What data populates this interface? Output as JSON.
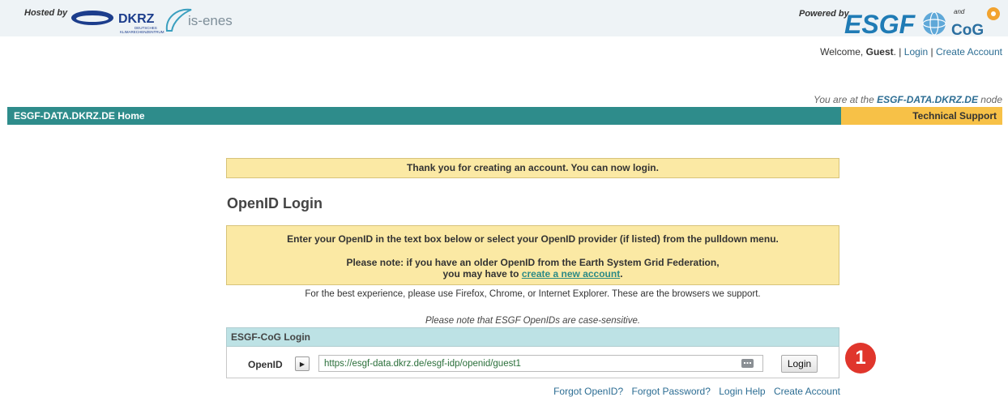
{
  "header": {
    "hosted_by": "Hosted by",
    "dkrz_name": "DKRZ",
    "dkrz_sub1": "DEUTSCHES",
    "dkrz_sub2": "KLIMARECHENZENTRUM",
    "isenes_name": "is-enes",
    "powered_by": "Powered by",
    "esgf_name": "ESGF",
    "cog_and": "and",
    "cog_name": "CoG",
    "welcome_prefix": "Welcome, ",
    "welcome_user": "Guest",
    "welcome_suffix": ".",
    "login_link": "Login",
    "create_account_link": "Create Account",
    "node_prefix": "You are at the ",
    "node_name": "ESGF-DATA.DKRZ.DE",
    "node_suffix": " node"
  },
  "nav": {
    "home": "ESGF-DATA.DKRZ.DE Home",
    "support": "Technical Support"
  },
  "main": {
    "thank_you": "Thank you for creating an account. You can now login.",
    "title": "OpenID Login",
    "info_line1": "Enter your OpenID in the text box below or select your OpenID provider (if listed) from the pulldown menu.",
    "info_line2": "Please note: if you have an older OpenID from the Earth System Grid Federation,",
    "info_line3_prefix": "you may have to ",
    "info_line3_link": "create a new account",
    "info_line3_suffix": ".",
    "browsers_note": "For the best experience, please use Firefox, Chrome, or Internet Explorer. These are the browsers we support.",
    "case_note": "Please note that ESGF OpenIDs are case-sensitive."
  },
  "login_form": {
    "header": "ESGF-CoG Login",
    "openid_label": "OpenID",
    "openid_value": "https://esgf-data.dkrz.de/esgf-idp/openid/guest1",
    "login_button": "Login",
    "annotation_number": "1"
  },
  "footer_links": {
    "forgot_openid": "Forgot OpenID?",
    "forgot_password": "Forgot Password?",
    "login_help": "Login Help",
    "create_account": "Create Account"
  },
  "colors": {
    "nav_bg": "#2e8c8b",
    "support_bg": "#f7c147",
    "notice_bg": "#fbe9a4",
    "login_header_bg": "#bde2e5",
    "badge": "#e0362c"
  }
}
